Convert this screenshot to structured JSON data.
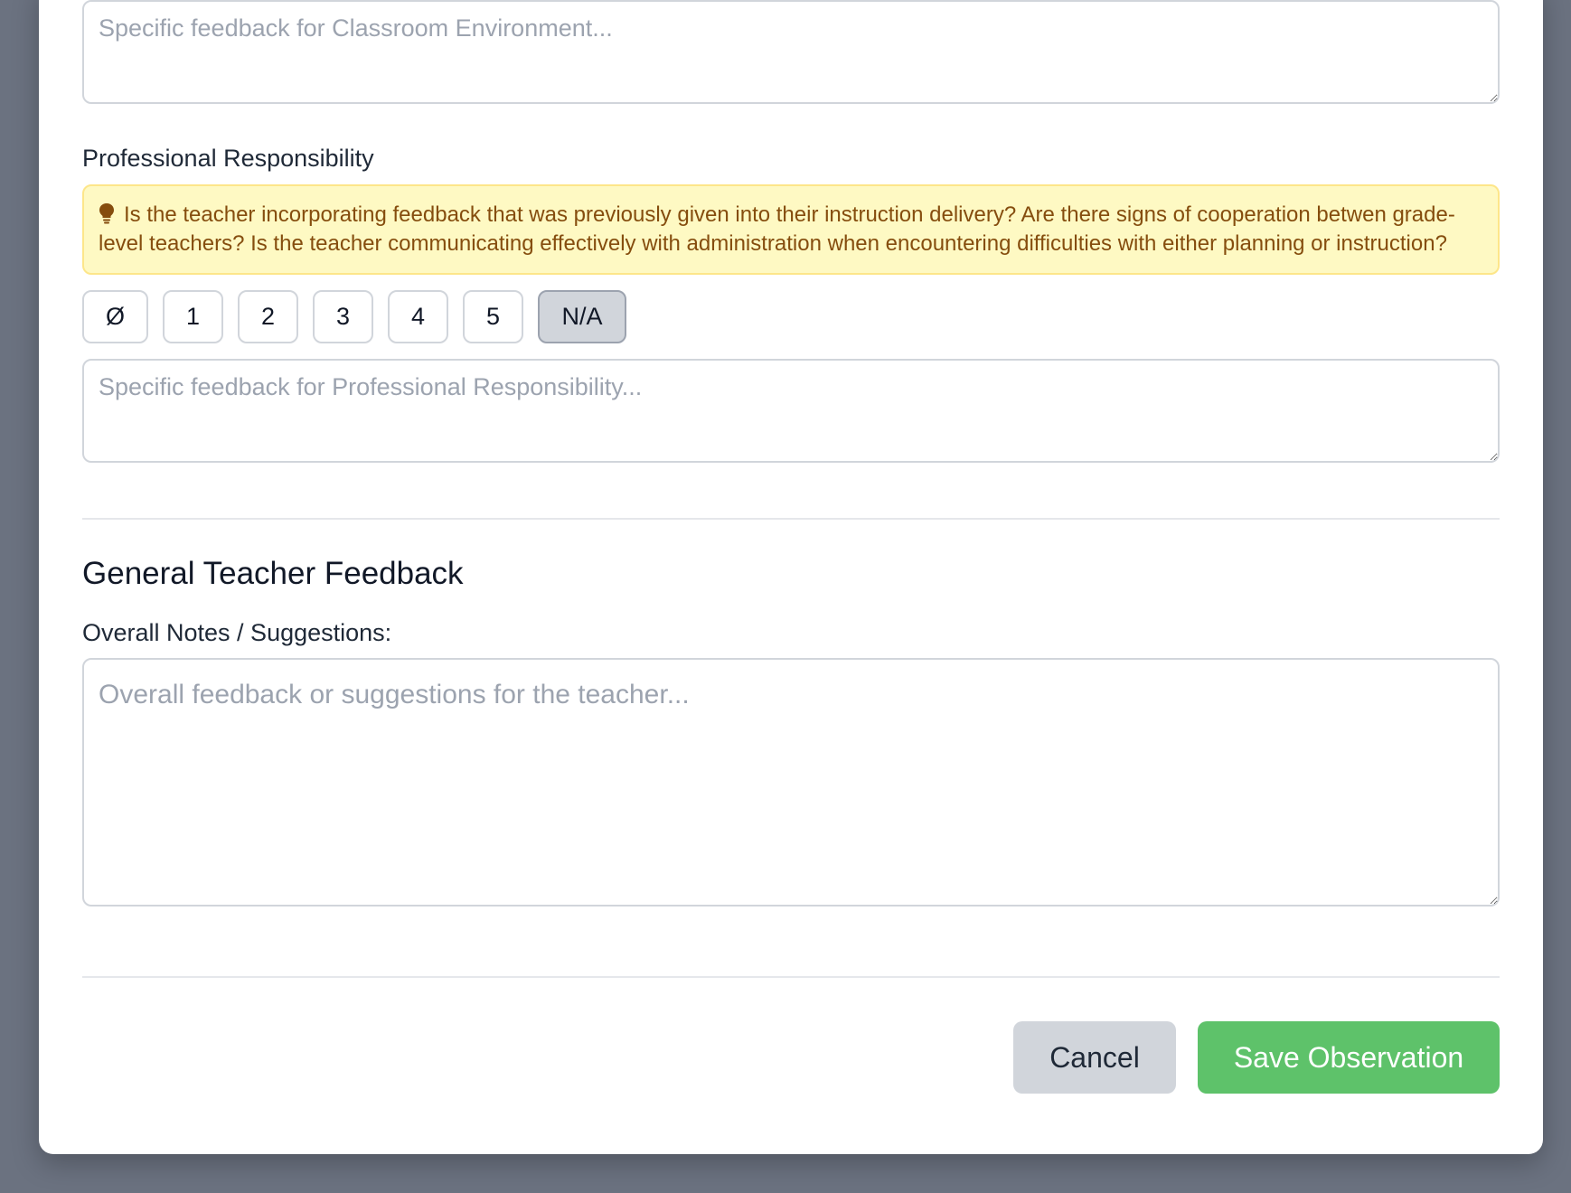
{
  "classroom_environment": {
    "feedback_placeholder": "Specific feedback for Classroom Environment..."
  },
  "professional_responsibility": {
    "label": "Professional Responsibility",
    "hint_icon": "lightbulb-icon",
    "hint_text": "Is the teacher incorporating feedback that was previously given into their instruction delivery? Are there signs of cooperation betwen grade-level teachers? Is the teacher communicating effectively with administration when encountering difficulties with either planning or instruction?",
    "rating_options": [
      "Ø",
      "1",
      "2",
      "3",
      "4",
      "5",
      "N/A"
    ],
    "selected_rating": "N/A",
    "feedback_placeholder": "Specific feedback for Professional Responsibility..."
  },
  "general_feedback": {
    "title": "General Teacher Feedback",
    "notes_label": "Overall Notes / Suggestions:",
    "notes_placeholder": "Overall feedback or suggestions for the teacher..."
  },
  "actions": {
    "cancel_label": "Cancel",
    "save_label": "Save Observation"
  },
  "colors": {
    "backdrop": "#6b7280",
    "hint_bg": "#fef9c3",
    "hint_text": "#854d0e",
    "save_button": "#5ec26a",
    "cancel_button": "#d1d5db"
  }
}
